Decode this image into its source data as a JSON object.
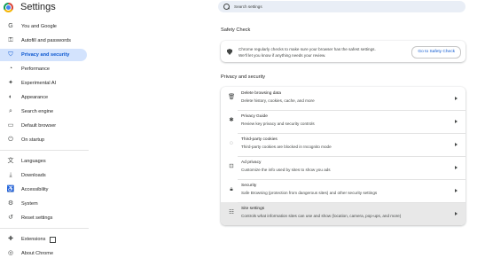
{
  "app": {
    "title": "Settings",
    "logo_icon": "chrome-logo-icon"
  },
  "search": {
    "placeholder": "Search settings"
  },
  "sidebar": {
    "items": [
      {
        "label": "You and Google",
        "icon": "google-icon",
        "active": false
      },
      {
        "label": "Autofill and passwords",
        "icon": "key-icon",
        "active": false
      },
      {
        "label": "Privacy and security",
        "icon": "shield-icon",
        "active": true
      },
      {
        "label": "Performance",
        "icon": "speedometer-icon",
        "active": false
      },
      {
        "label": "Experimental AI",
        "icon": "sparkle-icon",
        "active": false
      },
      {
        "label": "Appearance",
        "icon": "palette-icon",
        "active": false
      },
      {
        "label": "Search engine",
        "icon": "search-icon",
        "active": false
      },
      {
        "label": "Default browser",
        "icon": "browser-icon",
        "active": false
      },
      {
        "label": "On startup",
        "icon": "power-icon",
        "active": false
      },
      {
        "label": "Languages",
        "icon": "translate-icon",
        "active": false
      },
      {
        "label": "Downloads",
        "icon": "download-icon",
        "active": false
      },
      {
        "label": "Accessibility",
        "icon": "accessibility-icon",
        "active": false
      },
      {
        "label": "System",
        "icon": "wrench-icon",
        "active": false
      },
      {
        "label": "Reset settings",
        "icon": "reset-icon",
        "active": false
      },
      {
        "label": "Extensions",
        "icon": "puzzle-icon",
        "active": false
      },
      {
        "label": "About Chrome",
        "icon": "chrome-icon",
        "active": false
      }
    ]
  },
  "safety_check": {
    "heading": "Safety Check",
    "text_line1": "Chrome regularly checks to make sure your browser has the safest settings.",
    "text_line2": "We'll let you know if anything needs your review.",
    "button": "Go to Safety Check"
  },
  "privacy": {
    "heading": "Privacy and security",
    "rows": [
      {
        "title": "Delete browsing data",
        "subtitle": "Delete history, cookies, cache, and more",
        "icon": "trash-icon"
      },
      {
        "title": "Privacy Guide",
        "subtitle": "Review key privacy and security controls",
        "icon": "privacy-guide-icon"
      },
      {
        "title": "Third-party cookies",
        "subtitle": "Third-party cookies are blocked in Incognito mode",
        "icon": "cookie-icon"
      },
      {
        "title": "Ad privacy",
        "subtitle": "Customize the info used by sites to show you ads",
        "icon": "ad-privacy-icon"
      },
      {
        "title": "Security",
        "subtitle": "Safe Browsing (protection from dangerous sites) and other security settings",
        "icon": "lock-icon"
      },
      {
        "title": "Site settings",
        "subtitle": "Controls what information sites can use and show (location, camera, pop-ups, and more)",
        "icon": "site-settings-icon"
      }
    ]
  },
  "colors": {
    "accent": "#0b57d0",
    "active_bg": "#d3e3fd",
    "search_bg": "#e9eef6",
    "highlight_row": "#e8e8e8"
  }
}
